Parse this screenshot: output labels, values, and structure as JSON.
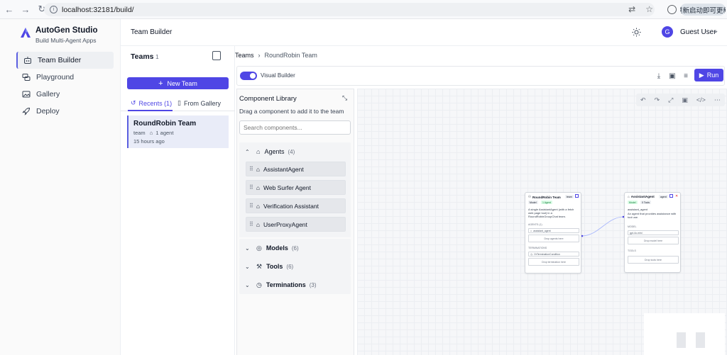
{
  "browser": {
    "url": "localhost:32181/build/",
    "update_label": "重新启动即可更新"
  },
  "sidebar": {
    "brand_title": "AutoGen Studio",
    "brand_subtitle": "Build Multi-Agent Apps",
    "items": [
      {
        "label": "Team Builder",
        "icon": "robot-icon",
        "active": true
      },
      {
        "label": "Playground",
        "icon": "chat-icon",
        "active": false
      },
      {
        "label": "Gallery",
        "icon": "gallery-icon",
        "active": false
      },
      {
        "label": "Deploy",
        "icon": "rocket-icon",
        "active": false
      }
    ]
  },
  "header": {
    "title": "Team Builder",
    "avatar_letter": "G",
    "user_name": "Guest User"
  },
  "teams": {
    "title": "Teams",
    "count": "1",
    "new_team_label": "New Team",
    "tab_recents": "Recents (1)",
    "tab_gallery": "From Gallery",
    "card": {
      "name": "RoundRobin Team",
      "type": "team",
      "agents": "1 agent",
      "time": "15 hours ago"
    }
  },
  "main": {
    "breadcrumb_root": "Teams",
    "breadcrumb_current": "RoundRobin Team",
    "visual_builder_label": "Visual Builder",
    "run_label": "Run"
  },
  "library": {
    "title": "Component Library",
    "hint": "Drag a component to add it to the team",
    "search_placeholder": "Search components...",
    "agents_label": "Agents",
    "agents_count": "(4)",
    "agents": [
      "AssistantAgent",
      "Web Surfer Agent",
      "Verification Assistant",
      "UserProxyAgent"
    ],
    "models_label": "Models",
    "models_count": "(6)",
    "tools_label": "Tools",
    "tools_count": "(6)",
    "terminations_label": "Terminations",
    "terminations_count": "(3)"
  },
  "team_node": {
    "title": "RoundRobin Team",
    "tag": "team",
    "pill_model": "Model",
    "pill_agents": "1 Agent",
    "desc": "A single AssistantAgent (with a fetch web page tool) in a RoundRobinGroupChat team.",
    "agents_heading": "AGENTS (1)",
    "agent_name": "assistant_agent",
    "drop_agents": "Drop agents here",
    "terminations_heading": "TERMINATIONS",
    "termination_name": "OrTerminationCondition",
    "drop_terminations": "Drop termination here"
  },
  "agent_node": {
    "title": "AssistantAgent",
    "tag": "agent",
    "pill_model": "Model",
    "pill_tools": "0 Tools",
    "name": "assistant_agent",
    "desc": "An agent that provides assistance with tool use.",
    "model_heading": "MODEL",
    "model_name": "gpt-4o-mini",
    "drop_model": "Drop model here",
    "tools_heading": "TOOLS",
    "drop_tools": "Drop tools here"
  },
  "colors": {
    "accent": "#4f46e5",
    "active_bg": "#e9ecf8"
  }
}
